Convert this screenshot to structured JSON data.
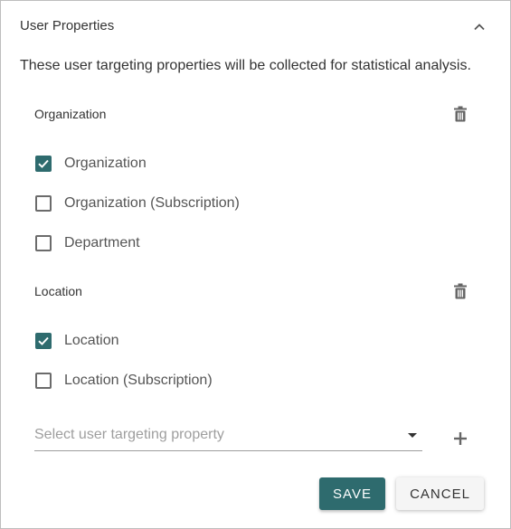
{
  "panel": {
    "title": "User Properties",
    "description": "These user targeting properties will be collected for statistical analysis."
  },
  "groups": [
    {
      "title": "Organization",
      "options": [
        {
          "label": "Organization",
          "checked": true
        },
        {
          "label": "Organization (Subscription)",
          "checked": false
        },
        {
          "label": "Department",
          "checked": false
        }
      ]
    },
    {
      "title": "Location",
      "options": [
        {
          "label": "Location",
          "checked": true
        },
        {
          "label": "Location (Subscription)",
          "checked": false
        }
      ]
    }
  ],
  "select": {
    "placeholder": "Select user targeting property"
  },
  "actions": {
    "save_label": "SAVE",
    "cancel_label": "CANCEL"
  },
  "icons": {
    "collapse": "chevron-up-icon",
    "delete": "trash-icon",
    "dropdown": "caret-down-icon",
    "add": "plus-icon",
    "check": "check-icon"
  },
  "colors": {
    "accent": "#2e6b6e",
    "border": "#bdbdbd",
    "icon": "#666666"
  }
}
